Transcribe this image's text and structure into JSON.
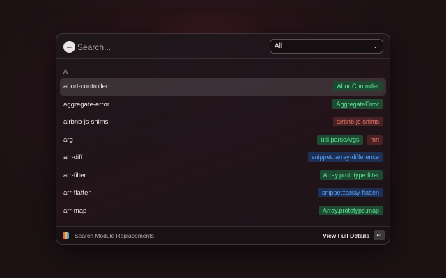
{
  "search": {
    "placeholder": "Search...",
    "back_icon": "arrow-left-icon"
  },
  "filter": {
    "selected": "All",
    "chevron_icon": "chevron-down-icon"
  },
  "section": {
    "letter": "A"
  },
  "items": [
    {
      "name": "abort-controller",
      "tags": [
        {
          "label": "AbortController",
          "color": "green"
        }
      ],
      "selected": true
    },
    {
      "name": "aggregate-error",
      "tags": [
        {
          "label": "AggregateError",
          "color": "green"
        }
      ]
    },
    {
      "name": "airbnb-js-shims",
      "tags": [
        {
          "label": "airbnb-js-shims",
          "color": "red"
        }
      ]
    },
    {
      "name": "arg",
      "tags": [
        {
          "label": "util.parseArgs",
          "color": "green"
        },
        {
          "label": "mri",
          "color": "red"
        }
      ]
    },
    {
      "name": "arr-diff",
      "tags": [
        {
          "label": "snippet::array-difference",
          "color": "blue"
        }
      ]
    },
    {
      "name": "arr-filter",
      "tags": [
        {
          "label": "Array.prototype.filter",
          "color": "green"
        }
      ]
    },
    {
      "name": "arr-flatten",
      "tags": [
        {
          "label": "snippet::array-flatten",
          "color": "blue"
        }
      ]
    },
    {
      "name": "arr-map",
      "tags": [
        {
          "label": "Array.prototype.map",
          "color": "green"
        }
      ]
    }
  ],
  "colors": {
    "green_bg": "#1e4a32",
    "green_fg": "#5fe29a",
    "blue_bg": "#1d2f52",
    "blue_fg": "#5a9ff3",
    "red_bg": "#4a2224",
    "red_fg": "#ee7a6e"
  },
  "footer": {
    "icon": "module-replacements-logo-icon",
    "label": "Search Module Replacements",
    "action": "View Full Details",
    "enter_icon": "enter-key-icon"
  }
}
